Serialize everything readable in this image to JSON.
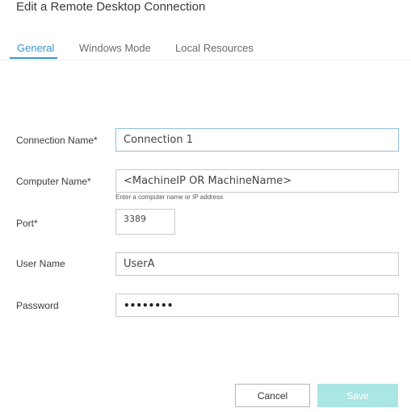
{
  "dialog": {
    "title": "Edit a Remote Desktop Connection"
  },
  "tabs": [
    {
      "label": "General",
      "active": true
    },
    {
      "label": "Windows Mode",
      "active": false
    },
    {
      "label": "Local Resources",
      "active": false
    }
  ],
  "form": {
    "connection_name": {
      "label": "Connection Name*",
      "value": "Connection 1"
    },
    "computer_name": {
      "label": "Computer Name*",
      "value": "<MachineIP OR MachineName>",
      "helper": "Enter a computer name or IP address"
    },
    "port": {
      "label": "Port*",
      "value": "3389"
    },
    "user_name": {
      "label": "User Name",
      "value": "UserA"
    },
    "password": {
      "label": "Password",
      "value": "••••••••"
    }
  },
  "buttons": {
    "cancel": "Cancel",
    "save": "Save"
  },
  "colors": {
    "accent": "#3b95d0",
    "save_button": "#a9e6e4"
  }
}
